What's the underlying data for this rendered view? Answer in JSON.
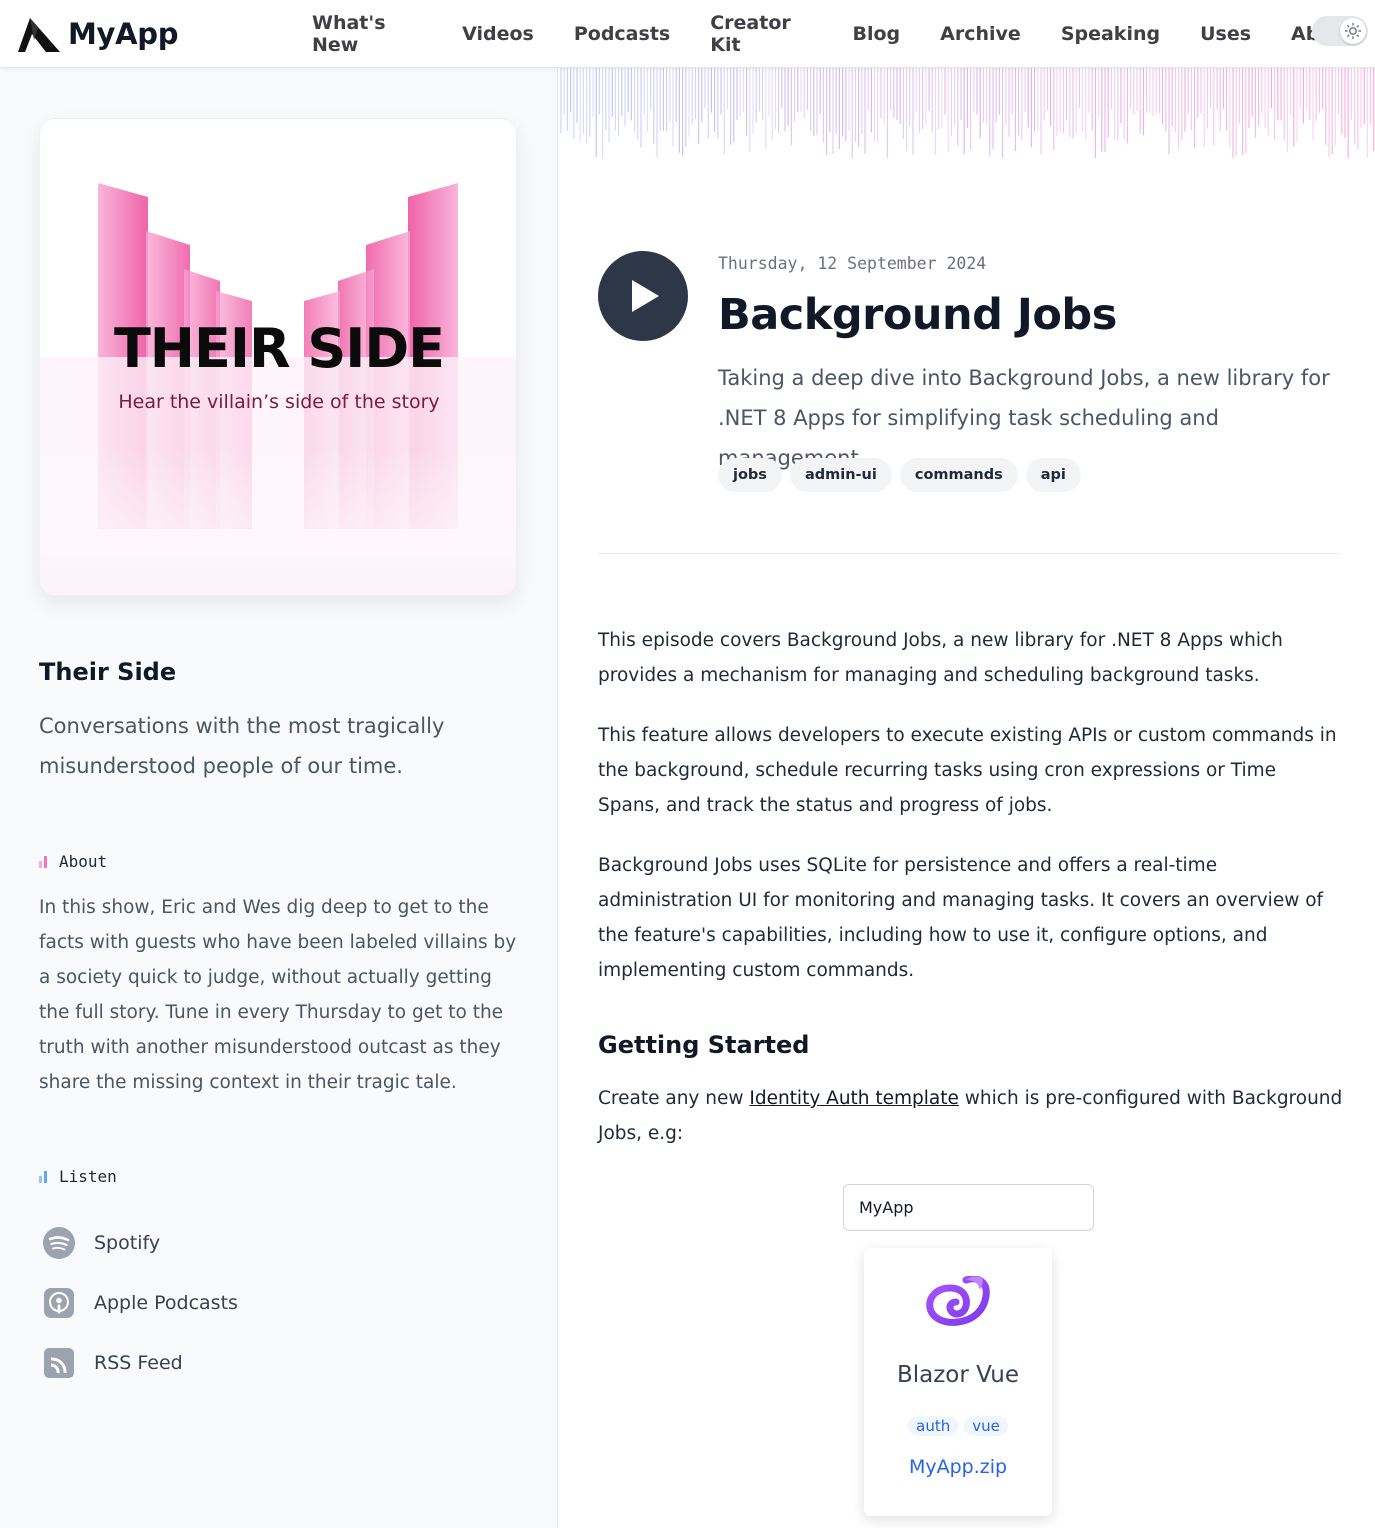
{
  "header": {
    "brand": "MyApp",
    "nav": [
      "What's New",
      "Videos",
      "Podcasts",
      "Creator Kit",
      "Blog",
      "Archive",
      "Speaking",
      "Uses",
      "About"
    ],
    "theme_icon": "sun-icon"
  },
  "podcast": {
    "cover_title": "THEIR SIDE",
    "cover_subtitle": "Hear the villain’s side of the story",
    "title": "Their Side",
    "description": "Conversations with the most tragically misunderstood people of our time.",
    "about_label": "About",
    "about_text": "In this show, Eric and Wes dig deep to get to the facts with guests who have been labeled villains by a society quick to judge, without actually getting the full story. Tune in every Thursday to get to the truth with another misunderstood outcast as they share the missing context in their tragic tale.",
    "listen_label": "Listen",
    "listen": [
      {
        "label": "Spotify",
        "icon": "spotify-icon"
      },
      {
        "label": "Apple Podcasts",
        "icon": "apple-podcasts-icon"
      },
      {
        "label": "RSS Feed",
        "icon": "rss-icon"
      }
    ]
  },
  "episode": {
    "date": "Thursday, 12 September 2024",
    "title": "Background Jobs",
    "summary": "Taking a deep dive into Background Jobs, a new library for .NET 8 Apps for simplifying task scheduling and management",
    "tags": [
      "jobs",
      "admin-ui",
      "commands",
      "api"
    ],
    "paragraphs": [
      "This episode covers Background Jobs, a new library for .NET 8 Apps which provides a mechanism for managing and scheduling background tasks.",
      "This feature allows developers to execute existing APIs or custom commands in the background, schedule recurring tasks using cron expressions or Time Spans, and track the status and progress of jobs.",
      "Background Jobs uses SQLite for persistence and offers a real-time administration UI for monitoring and managing tasks. It covers an overview of the feature's capabilities, including how to use it, configure options, and implementing custom commands."
    ],
    "getting_started_heading": "Getting Started",
    "getting_started_before": "Create any new ",
    "getting_started_link": "Identity Auth template",
    "getting_started_after": " which is pre-configured with Background Jobs, e.g:",
    "project_name_value": "MyApp"
  },
  "template_card": {
    "icon": "blazor-icon",
    "name": "Blazor Vue",
    "tags": [
      "auth",
      "vue"
    ],
    "download": "MyApp.zip"
  },
  "colors": {
    "accent_pink": "#ec4899",
    "play_button": "#2d3748",
    "link_blue": "#2563eb"
  }
}
